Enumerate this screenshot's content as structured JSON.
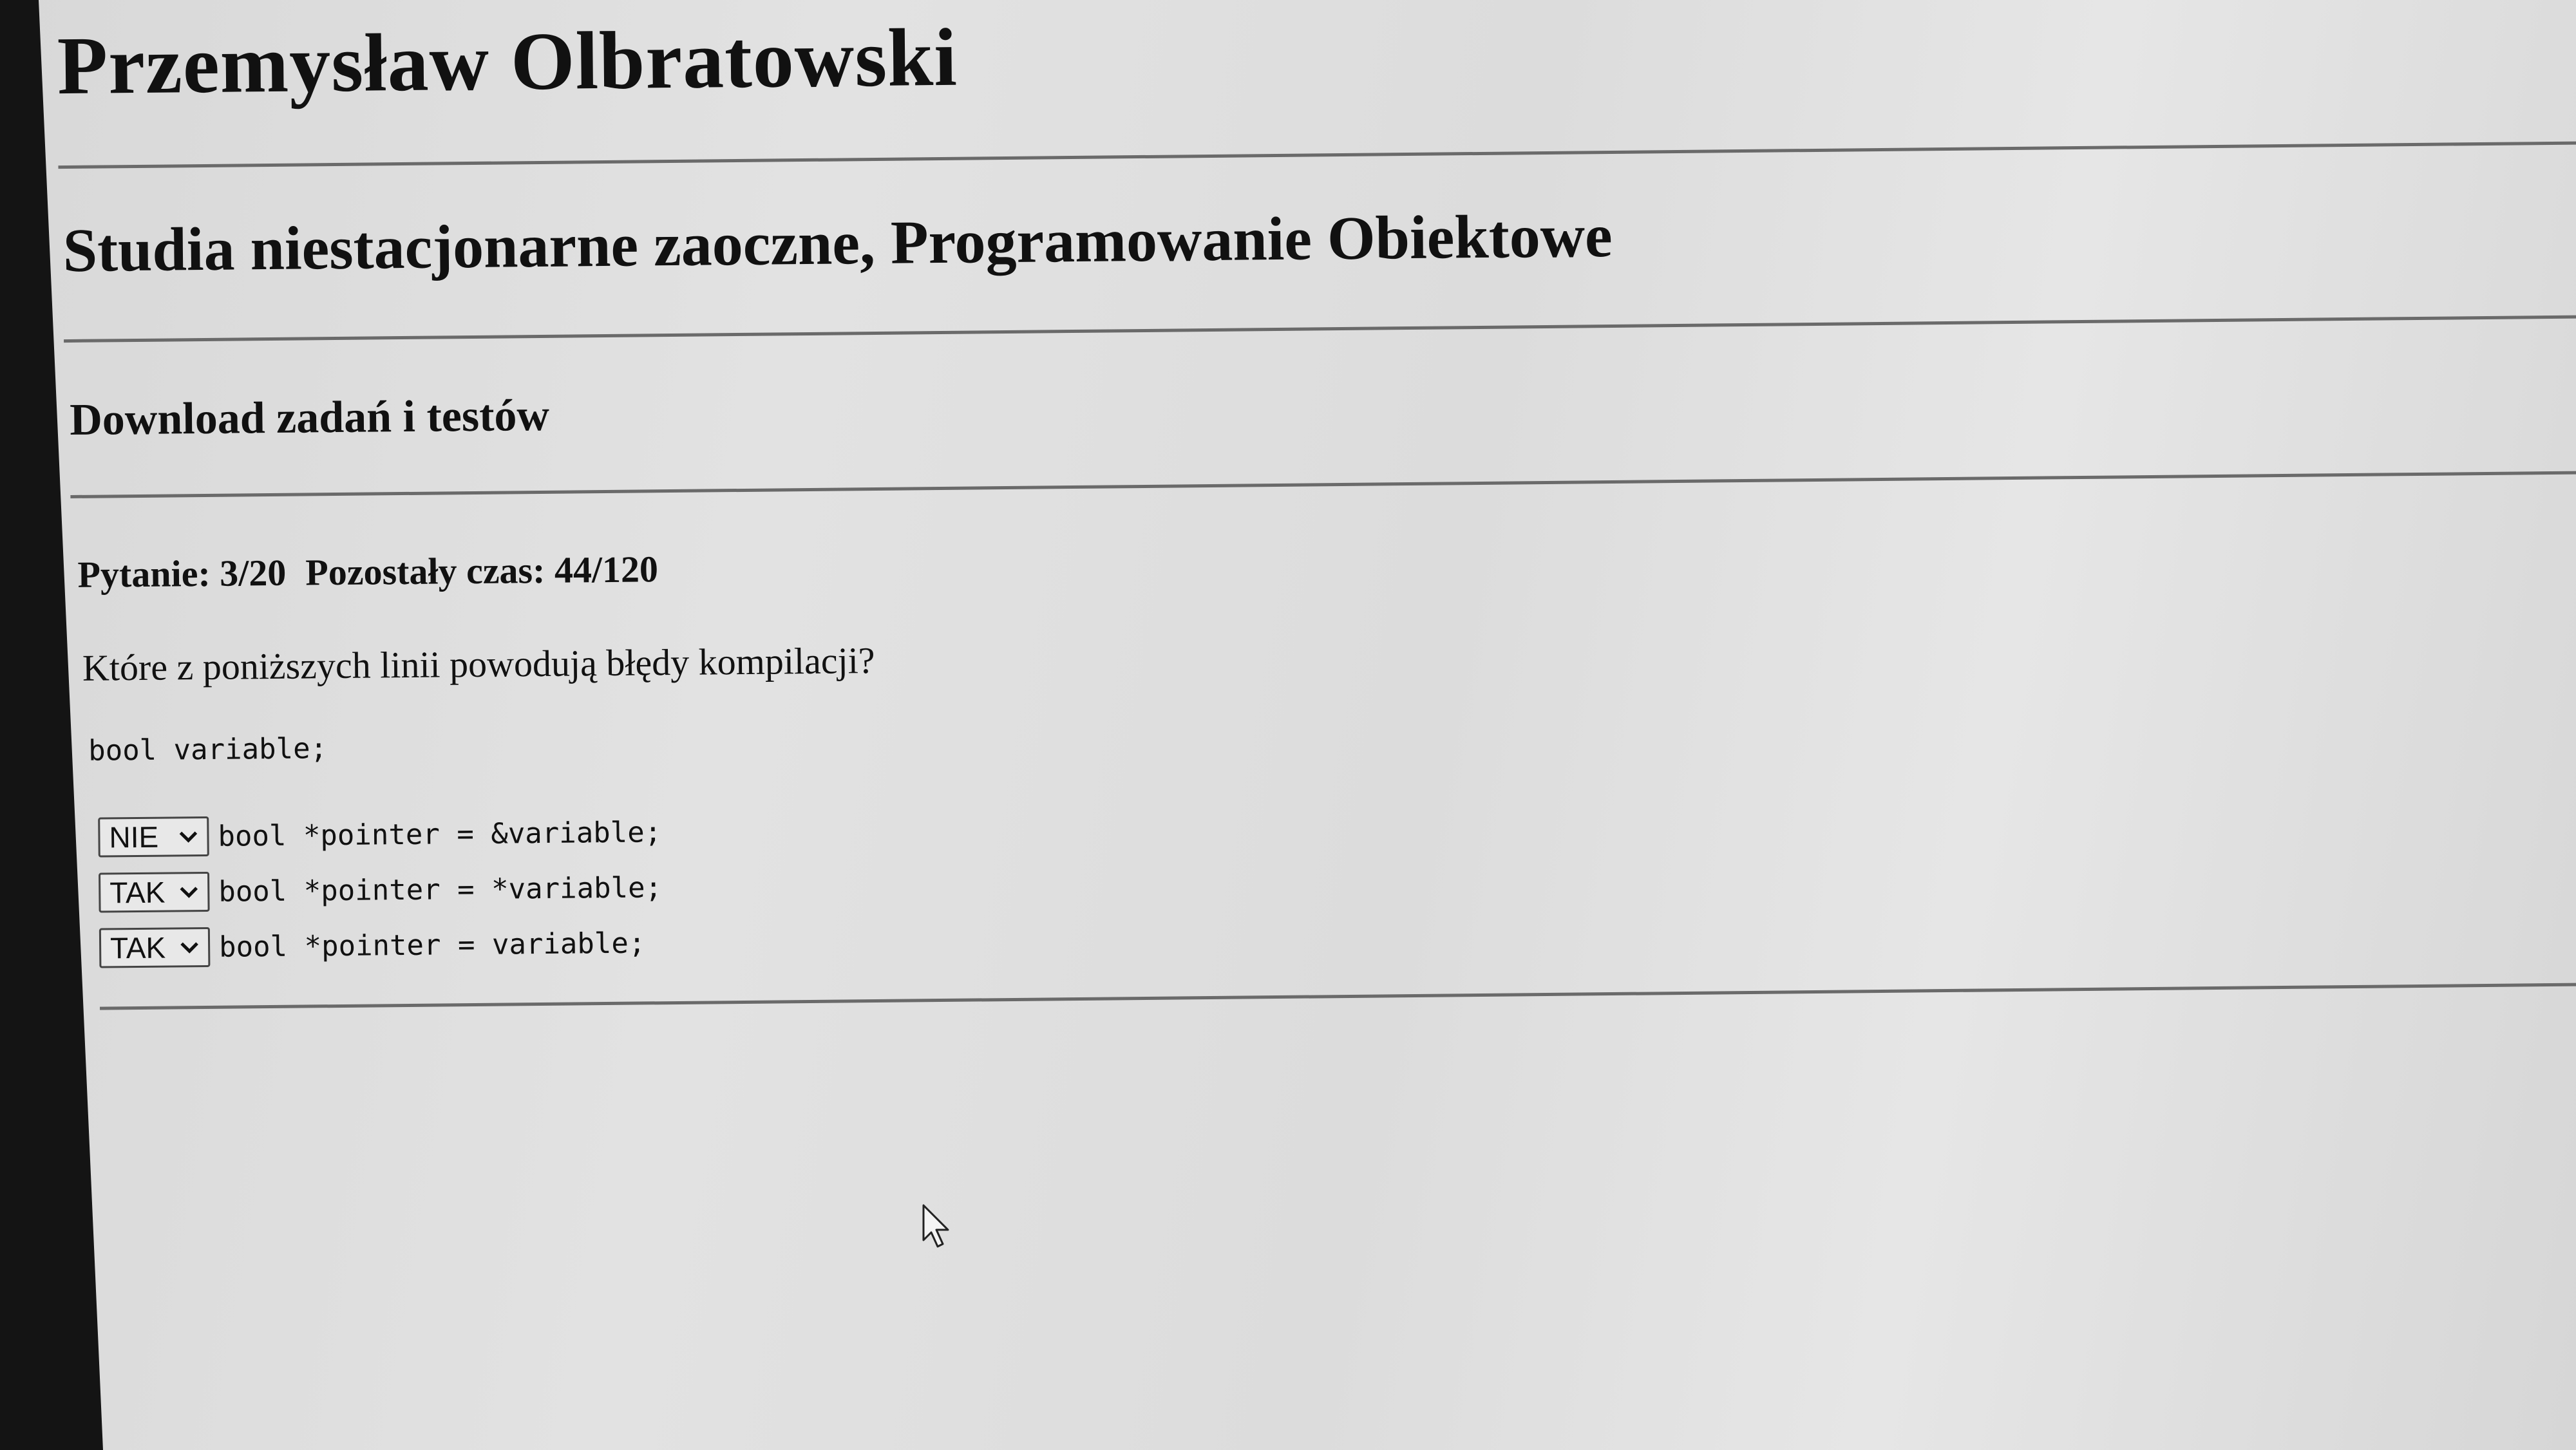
{
  "header": {
    "name": "Przemysław Olbratowski",
    "course": "Studia niestacjonarne zaoczne, Programowanie Obiektowe",
    "section": "Download zadań i testów"
  },
  "quiz": {
    "question_label": "Pytanie: 3/20",
    "time_label": "Pozostały czas: 44/120",
    "question_text": "Które z poniższych linii powodują błędy kompilacji?",
    "declaration": "bool variable;",
    "answers": [
      {
        "selected": "NIE",
        "code": "bool *pointer = &variable;"
      },
      {
        "selected": "TAK",
        "code": "bool *pointer = *variable;"
      },
      {
        "selected": "TAK",
        "code": "bool *pointer = variable;"
      }
    ],
    "options": [
      "TAK",
      "NIE"
    ]
  },
  "icons": {
    "dropdown": "chevron-down-icon",
    "cursor": "mouse-pointer-icon"
  }
}
